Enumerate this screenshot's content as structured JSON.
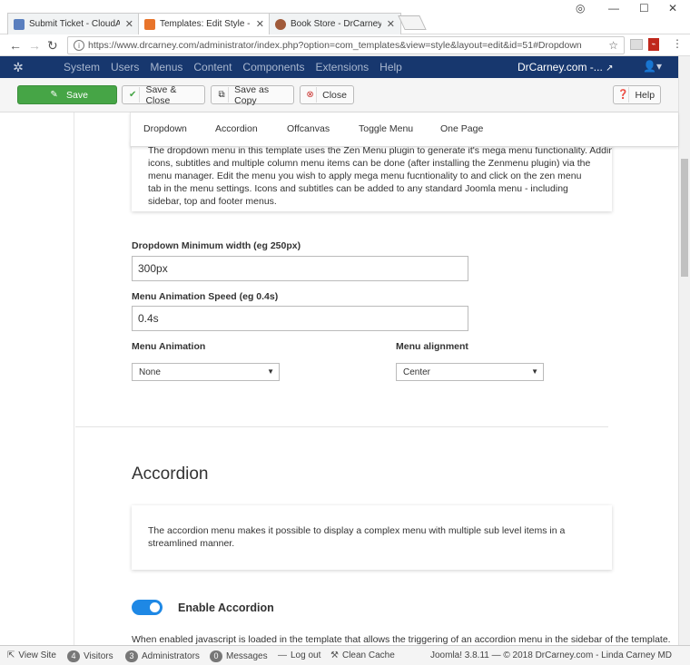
{
  "browser": {
    "tabs": [
      {
        "label": "Submit Ticket - CloudAc",
        "icon_color": "#5a7fbf"
      },
      {
        "label": "Templates: Edit Style - Dr",
        "icon_color": "#e8742a"
      },
      {
        "label": "Book Store - DrCarney.co",
        "icon_color": "#a05a3a"
      }
    ],
    "url": "https://www.drcarney.com/administrator/index.php?option=com_templates&view=style&layout=edit&id=51#Dropdown"
  },
  "jnav": {
    "menu": [
      "System",
      "Users",
      "Menus",
      "Content",
      "Components",
      "Extensions",
      "Help"
    ],
    "site_link": "DrCarney.com -...",
    "colors": {
      "bar": "#17376e"
    }
  },
  "toolbar": {
    "save": "Save",
    "save_close": "Save & Close",
    "save_copy": "Save as Copy",
    "close": "Close",
    "help": "Help"
  },
  "subtabs": [
    "Dropdown",
    "Accordion",
    "Offcanvas",
    "Toggle Menu",
    "One Page"
  ],
  "dropdown": {
    "info_first_line": "The dropdown menu in this template uses the Zen Menu plugin to generate it's mega menu functionality. Adding",
    "info_rest": "icons, subtitles and multiple column menu items can be done (after installing the Zenmenu plugin) via the menu manager. Edit the menu you wish to apply mega menu fucntionality to and click on the zen menu tab in the menu settings. Icons and subtitles can be added to any standard Joomla menu - including sidebar, top and footer menus.",
    "min_width_label": "Dropdown Minimum width (eg 250px)",
    "min_width_value": "300px",
    "speed_label": "Menu Animation Speed (eg 0.4s)",
    "speed_value": "0.4s",
    "animation_label": "Menu Animation",
    "animation_value": "None",
    "alignment_label": "Menu alignment",
    "alignment_value": "Center"
  },
  "accordion": {
    "heading": "Accordion",
    "info": "The accordion menu makes it possible to display a complex menu with multiple sub level items in a streamlined manner.",
    "toggle_label": "Enable Accordion",
    "toggle_on": true,
    "description": "When enabled javascript is loaded in the template that allows the triggering of an accordion menu in the sidebar of the template."
  },
  "statusbar": {
    "view_site": "View Site",
    "visitors_count": "4",
    "visitors": "Visitors",
    "admins_count": "3",
    "admins": "Administrators",
    "messages_count": "0",
    "messages": "Messages",
    "logout": "Log out",
    "clean_cache": "Clean Cache",
    "version": "Joomla! 3.8.11",
    "copyright": "— © 2018 DrCarney.com - Linda Carney MD"
  }
}
